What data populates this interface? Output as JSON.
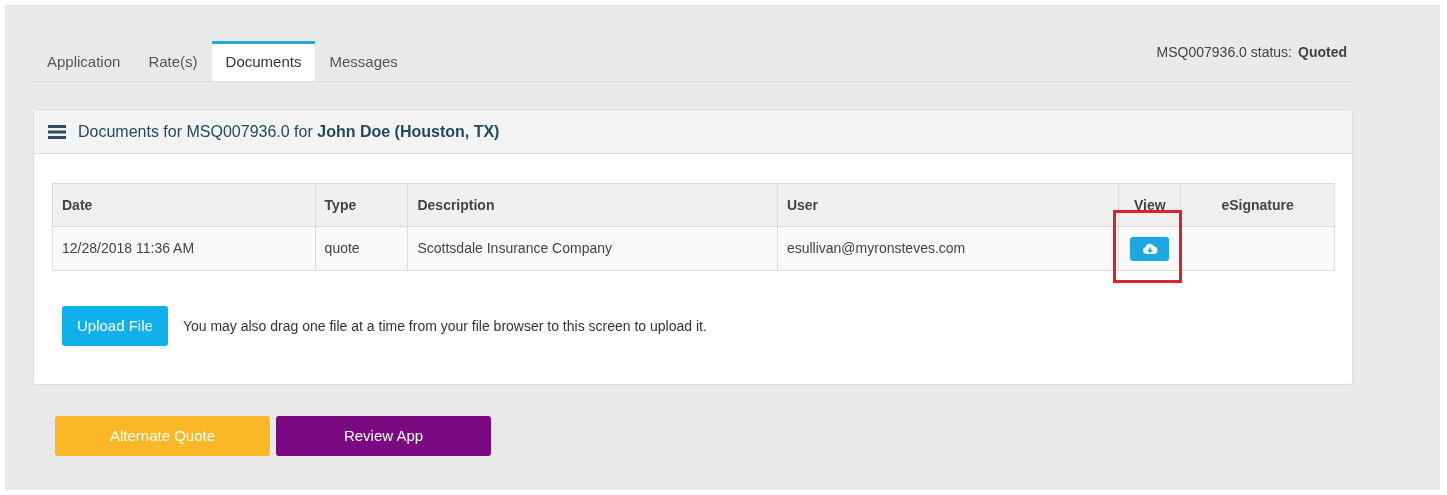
{
  "tabs": [
    {
      "label": "Application",
      "selected": false
    },
    {
      "label": "Rate(s)",
      "selected": false
    },
    {
      "label": "Documents",
      "selected": true
    },
    {
      "label": "Messages",
      "selected": false
    }
  ],
  "status": {
    "label": "MSQ007936.0 status:",
    "value": "Quoted"
  },
  "panel": {
    "title": "Documents for MSQ007936.0 for **John Doe (Houston, TX)**"
  },
  "table": {
    "columns": [
      "Date",
      "Type",
      "Description",
      "User",
      "View",
      "eSignature"
    ],
    "rows": [
      {
        "date": "12/28/2018 11:36 AM",
        "type": "quote",
        "description": "Scottsdale Insurance Company",
        "user": "esullivan@myronsteves.com",
        "highlighted": true
      }
    ]
  },
  "upload": {
    "button": "Upload File",
    "hint": "You may also drag one file at a time from your file browser to this screen to upload it."
  },
  "actions": [
    {
      "label": "Alternate Quote",
      "color": "#fbb826"
    },
    {
      "label": "Review App",
      "color": "#7b0a82"
    }
  ]
}
